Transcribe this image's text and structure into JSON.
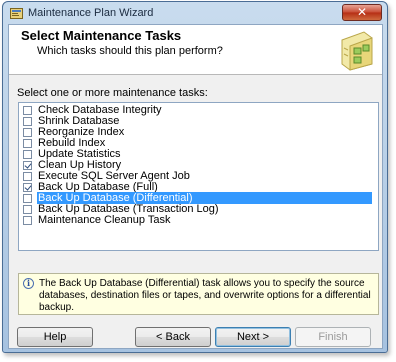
{
  "window": {
    "title": "Maintenance Plan Wizard",
    "close_glyph": "✕"
  },
  "header": {
    "title": "Select Maintenance Tasks",
    "subtitle": "Which tasks should this plan perform?"
  },
  "prompt": "Select one or more maintenance tasks:",
  "tasks": [
    {
      "label": "Check Database Integrity",
      "checked": false,
      "selected": false
    },
    {
      "label": "Shrink Database",
      "checked": false,
      "selected": false
    },
    {
      "label": "Reorganize Index",
      "checked": false,
      "selected": false
    },
    {
      "label": "Rebuild Index",
      "checked": false,
      "selected": false
    },
    {
      "label": "Update Statistics",
      "checked": false,
      "selected": false
    },
    {
      "label": "Clean Up History",
      "checked": true,
      "selected": false
    },
    {
      "label": "Execute SQL Server Agent Job",
      "checked": false,
      "selected": false
    },
    {
      "label": "Back Up Database (Full)",
      "checked": true,
      "selected": false
    },
    {
      "label": "Back Up Database (Differential)",
      "checked": false,
      "selected": true
    },
    {
      "label": "Back Up Database (Transaction Log)",
      "checked": false,
      "selected": false
    },
    {
      "label": "Maintenance Cleanup Task",
      "checked": false,
      "selected": false
    }
  ],
  "info": {
    "icon": "info-icon",
    "text": "The Back Up Database (Differential) task allows you to specify the source databases, destination files or tapes, and overwrite options for a differential backup."
  },
  "buttons": {
    "help": "Help",
    "back": "< Back",
    "next": "Next >",
    "finish": "Finish"
  },
  "colors": {
    "selection": "#3399ff",
    "info_background": "#ffffe1",
    "titlebar": "#a6c2e0"
  }
}
